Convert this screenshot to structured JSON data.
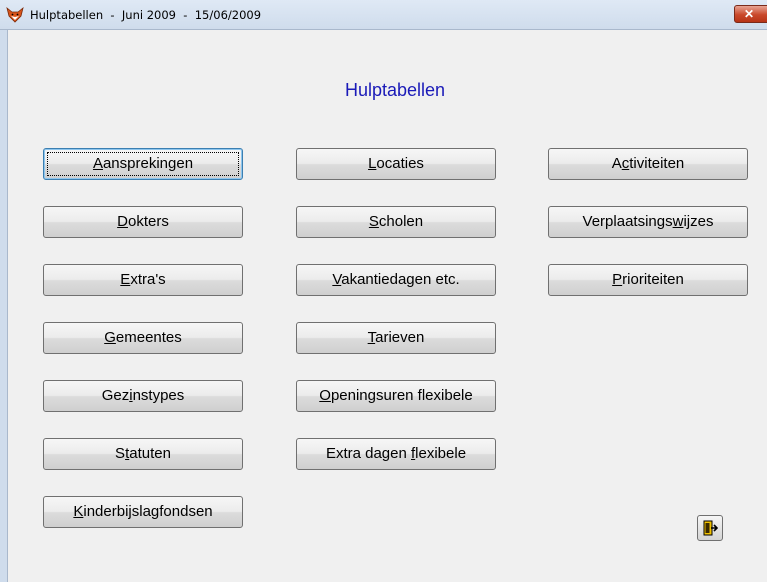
{
  "window": {
    "title": "Hulptabellen  -  Juni 2009  -  15/06/2009",
    "close_label": "✕"
  },
  "main": {
    "heading": "Hulptabellen",
    "buttons": [
      {
        "pre": "",
        "key": "A",
        "post": "ansprekingen"
      },
      {
        "pre": "",
        "key": "D",
        "post": "okters"
      },
      {
        "pre": "",
        "key": "E",
        "post": "xtra's"
      },
      {
        "pre": "",
        "key": "G",
        "post": "emeentes"
      },
      {
        "pre": "Gez",
        "key": "i",
        "post": "nstypes"
      },
      {
        "pre": "S",
        "key": "t",
        "post": "atuten"
      },
      {
        "pre": "",
        "key": "K",
        "post": "inderbijslagfondsen"
      },
      {
        "pre": "",
        "key": "L",
        "post": "ocaties"
      },
      {
        "pre": "",
        "key": "S",
        "post": "cholen"
      },
      {
        "pre": "",
        "key": "V",
        "post": "akantiedagen etc."
      },
      {
        "pre": "",
        "key": "T",
        "post": "arieven"
      },
      {
        "pre": "",
        "key": "O",
        "post": "peningsuren flexibele"
      },
      {
        "pre": "Extra dagen ",
        "key": "f",
        "post": "lexibele"
      },
      {
        "pre": "A",
        "key": "c",
        "post": "tiviteiten"
      },
      {
        "pre": "Verplaatsings",
        "key": "w",
        "post": "ijzes"
      },
      {
        "pre": "",
        "key": "P",
        "post": "rioriteiten"
      }
    ]
  },
  "colors": {
    "heading": "#1a1ab8",
    "close_button": "#c9482b"
  },
  "icons": {
    "app": "fox-head-icon",
    "exit": "exit-door-icon"
  }
}
